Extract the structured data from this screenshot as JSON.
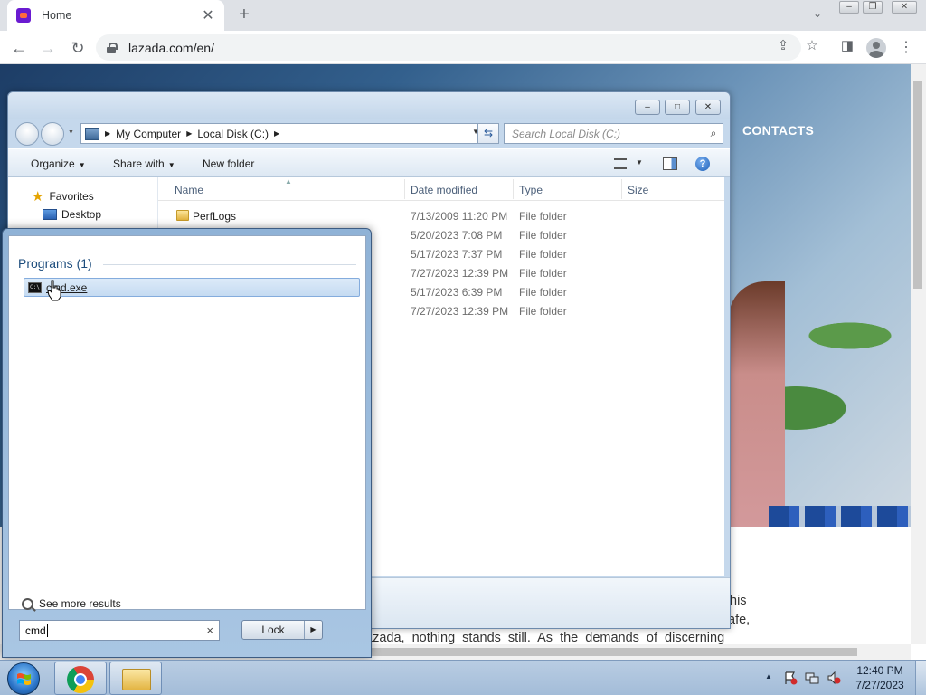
{
  "browser": {
    "tab_title": "Home",
    "tab_close": "✕",
    "new_tab": "+",
    "url": "lazada.com/en/",
    "accent": "#6a1bd1"
  },
  "web": {
    "nav_contacts": "CONTACTS",
    "text_line1": "his",
    "text_line2": "afe,",
    "text_line3": "azada, nothing stands still. As the demands of discerning"
  },
  "explorer": {
    "crumbs": [
      "My Computer",
      "Local Disk (C:)"
    ],
    "search_placeholder": "Search Local Disk (C:)",
    "toolbar": {
      "organize": "Organize",
      "share_with": "Share with",
      "new_folder": "New folder"
    },
    "nav": {
      "favorites": "Favorites",
      "desktop": "Desktop"
    },
    "columns": {
      "name": "Name",
      "date_modified": "Date modified",
      "type": "Type",
      "size": "Size"
    },
    "files": [
      {
        "name": "PerfLogs",
        "date": "7/13/2009 11:20 PM",
        "type": "File folder"
      },
      {
        "name": "",
        "date": "5/20/2023 7:08 PM",
        "type": "File folder"
      },
      {
        "name": "",
        "date": "5/17/2023 7:37 PM",
        "type": "File folder"
      },
      {
        "name": "",
        "date": "7/27/2023 12:39 PM",
        "type": "File folder"
      },
      {
        "name": "",
        "date": "5/17/2023 6:39 PM",
        "type": "File folder"
      },
      {
        "name": "",
        "date": "7/27/2023 12:39 PM",
        "type": "File folder"
      }
    ]
  },
  "start_menu": {
    "programs_header": "Programs (1)",
    "result_cmd": "cmd.exe",
    "see_more": "See more results",
    "search_value": "cmd",
    "clear": "×",
    "lock_label": "Lock"
  },
  "taskbar": {
    "time": "12:40 PM",
    "date": "7/27/2023"
  },
  "icons": [
    "search-icon",
    "star-icon",
    "folder-icon",
    "help-icon",
    "cmd-icon",
    "hand-cursor-icon",
    "chrome-icon",
    "start-orb-icon",
    "explorer-icon"
  ]
}
